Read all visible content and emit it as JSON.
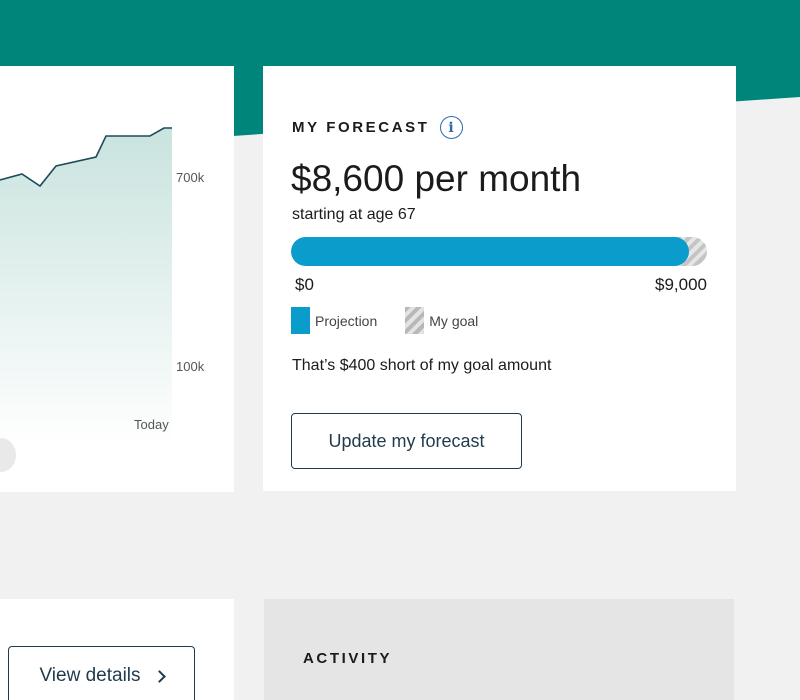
{
  "colors": {
    "brand_teal": "#00857a",
    "projection_blue": "#0a9ccb",
    "button_border": "#1f3b4d",
    "info_blue": "#2b6cb0"
  },
  "chart": {
    "tick_700k": "700k",
    "tick_100k": "100k",
    "tick_today": "Today"
  },
  "forecast": {
    "title": "MY FORECAST",
    "info_icon": "info-icon",
    "amount": "$8,600 per month",
    "subtitle": "starting at age 67",
    "progress": {
      "projection": 8600,
      "goal": 9000,
      "fraction": 0.956
    },
    "min_label": "$0",
    "max_label": "$9,000",
    "legend": {
      "projection": "Projection",
      "goal": "My goal"
    },
    "short_note": "That’s $400 short of my goal amount",
    "update_button": "Update my forecast"
  },
  "details": {
    "view_button": "View details",
    "chevron_icon": "chevron-right-icon"
  },
  "activity": {
    "title": "ACTIVITY"
  }
}
